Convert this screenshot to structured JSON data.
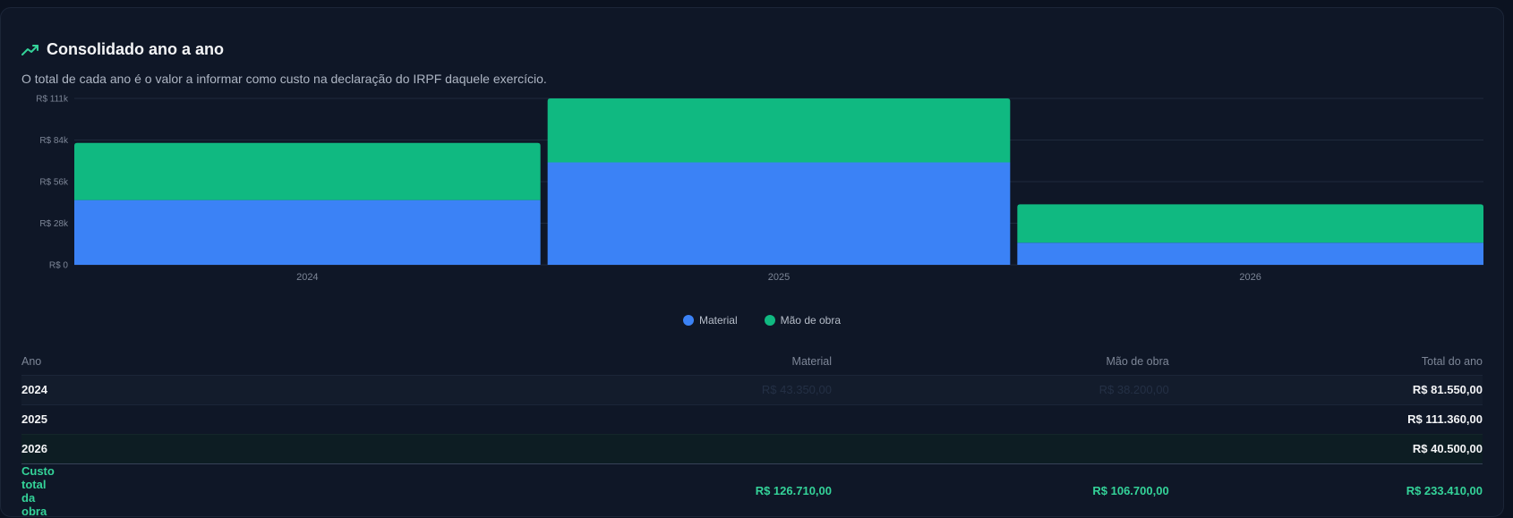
{
  "header": {
    "title": "Consolidado ano a ano",
    "subtitle": "O total de cada ano é o valor a informar como custo na declaração do IRPF daquele exercício.",
    "icon": "trending-up-icon"
  },
  "colors": {
    "material": "#3b82f6",
    "labor": "#10b981",
    "accent": "#34d399",
    "grid": "#1f2a3c",
    "axis_text": "#7d8697"
  },
  "chart_data": {
    "type": "bar",
    "stacked": true,
    "categories": [
      "2024",
      "2025",
      "2026"
    ],
    "series": [
      {
        "name": "Material",
        "values": [
          43350,
          68550,
          14810
        ]
      },
      {
        "name": "Mão de obra",
        "values": [
          38200,
          42810,
          25690
        ]
      }
    ],
    "y_ticks": [
      "R$ 0",
      "R$ 28k",
      "R$ 56k",
      "R$ 84k",
      "R$ 111k"
    ],
    "y_tick_values": [
      0,
      27840,
      55680,
      83520,
      111360
    ],
    "ylim": [
      0,
      111360
    ],
    "grid": true,
    "legend": "bottom-center"
  },
  "table": {
    "headers": [
      "Ano",
      "Material",
      "Mão de obra",
      "Total do ano"
    ],
    "rows": [
      {
        "year": "2024",
        "material": "R$ 43.350,00",
        "labor": "R$ 38.200,00",
        "total": "R$ 81.550,00"
      },
      {
        "year": "2025",
        "material": "",
        "labor": "",
        "total": "R$ 111.360,00"
      },
      {
        "year": "2026",
        "material": "",
        "labor": "",
        "total": "R$ 40.500,00"
      }
    ],
    "footer": {
      "label": "Custo total da obra",
      "material": "R$ 126.710,00",
      "labor": "R$ 106.700,00",
      "total": "R$ 233.410,00"
    }
  }
}
